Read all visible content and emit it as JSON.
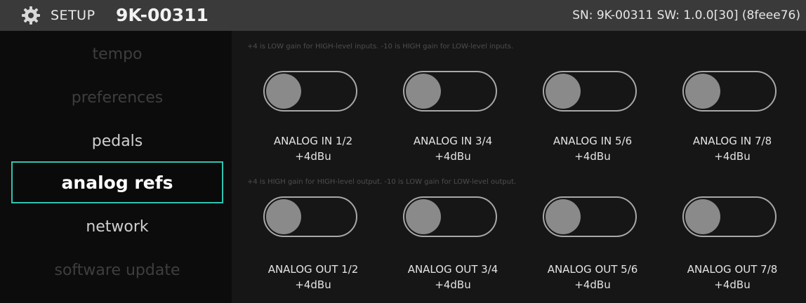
{
  "header": {
    "setup_label": "SETUP",
    "device_id": "9K-00311",
    "sn_info": "SN: 9K-00311 SW: 1.0.0[30] (8feee76)",
    "icon": "gear-icon"
  },
  "sidebar": {
    "items": [
      {
        "label": "tempo",
        "state": "dim"
      },
      {
        "label": "preferences",
        "state": "dim"
      },
      {
        "label": "pedals",
        "state": "normal"
      },
      {
        "label": "analog refs",
        "state": "selected"
      },
      {
        "label": "network",
        "state": "normal"
      },
      {
        "label": "software update",
        "state": "dim"
      }
    ]
  },
  "inputs": {
    "note": "+4 is LOW gain for HIGH-level inputs. -10 is HIGH gain for LOW-level inputs.",
    "channels": [
      {
        "label": "ANALOG IN 1/2",
        "value": "+4dBu"
      },
      {
        "label": "ANALOG IN 3/4",
        "value": "+4dBu"
      },
      {
        "label": "ANALOG IN 5/6",
        "value": "+4dBu"
      },
      {
        "label": "ANALOG IN 7/8",
        "value": "+4dBu"
      }
    ]
  },
  "outputs": {
    "note": "+4 is HIGH gain for HIGH-level output. -10 is LOW gain for LOW-level output.",
    "channels": [
      {
        "label": "ANALOG OUT 1/2",
        "value": "+4dBu"
      },
      {
        "label": "ANALOG OUT 3/4",
        "value": "+4dBu"
      },
      {
        "label": "ANALOG OUT 5/6",
        "value": "+4dBu"
      },
      {
        "label": "ANALOG OUT 7/8",
        "value": "+4dBu"
      }
    ]
  },
  "colors": {
    "accent": "#2ec4b0",
    "header_bg": "#3a3a3a",
    "panel_bg": "#161616",
    "knob": "#8a8a8a"
  }
}
